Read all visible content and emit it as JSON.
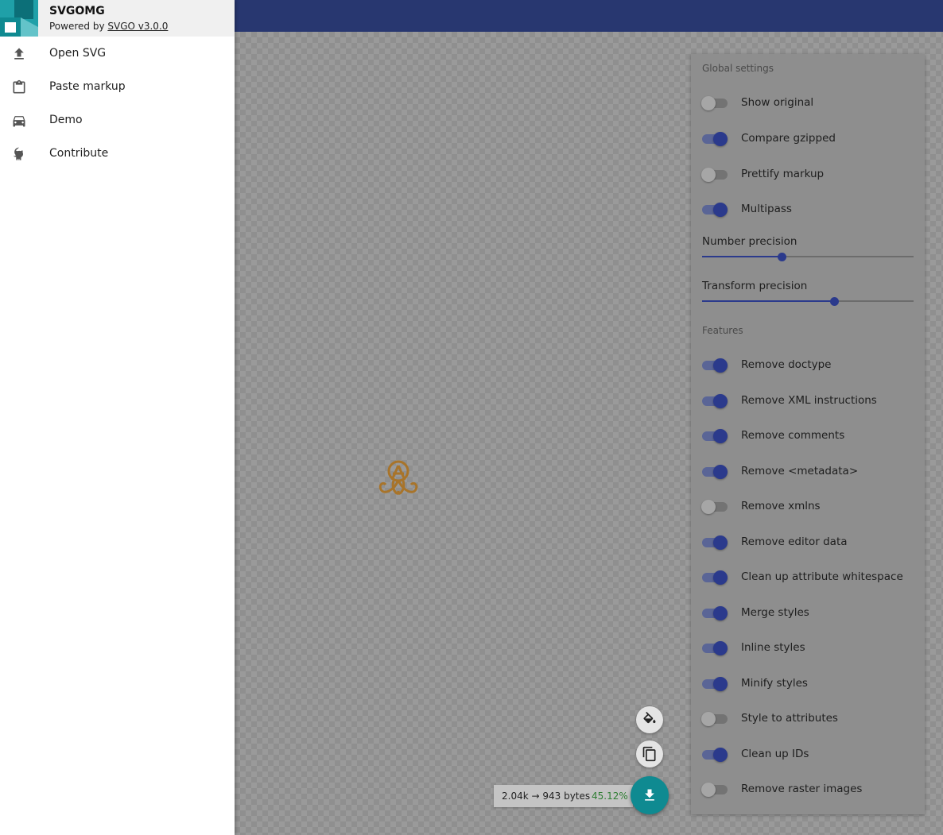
{
  "app": {
    "title": "SVGOMG",
    "powered_prefix": "Powered by ",
    "powered_link": "SVGO v3.0.0"
  },
  "menu": {
    "items": [
      {
        "label": "Open SVG",
        "icon": "upload-icon"
      },
      {
        "label": "Paste markup",
        "icon": "clipboard-icon"
      },
      {
        "label": "Demo",
        "icon": "car-icon"
      },
      {
        "label": "Contribute",
        "icon": "github-icon"
      }
    ]
  },
  "settings": {
    "global_title": "Global settings",
    "global": [
      {
        "label": "Show original",
        "on": false
      },
      {
        "label": "Compare gzipped",
        "on": true
      },
      {
        "label": "Prettify markup",
        "on": false
      },
      {
        "label": "Multipass",
        "on": true
      }
    ],
    "number_precision": {
      "label": "Number precision",
      "level": 0.375
    },
    "transform_precision": {
      "label": "Transform precision",
      "level": 0.625
    },
    "features_title": "Features",
    "features": [
      {
        "label": "Remove doctype",
        "on": true
      },
      {
        "label": "Remove XML instructions",
        "on": true
      },
      {
        "label": "Remove comments",
        "on": true
      },
      {
        "label": "Remove <metadata>",
        "on": true
      },
      {
        "label": "Remove xmlns",
        "on": false
      },
      {
        "label": "Remove editor data",
        "on": true
      },
      {
        "label": "Clean up attribute whitespace",
        "on": true
      },
      {
        "label": "Merge styles",
        "on": true
      },
      {
        "label": "Inline styles",
        "on": true
      },
      {
        "label": "Minify styles",
        "on": true
      },
      {
        "label": "Style to attributes",
        "on": false
      },
      {
        "label": "Clean up IDs",
        "on": true
      },
      {
        "label": "Remove raster images",
        "on": false
      }
    ]
  },
  "output": {
    "size_text": "2.04k → 943 bytes",
    "percent": "45.12%"
  },
  "colors": {
    "header": "#283770",
    "accent": "#2b3a8c",
    "fab": "#0f8a91",
    "savings": "#2e7d32"
  }
}
